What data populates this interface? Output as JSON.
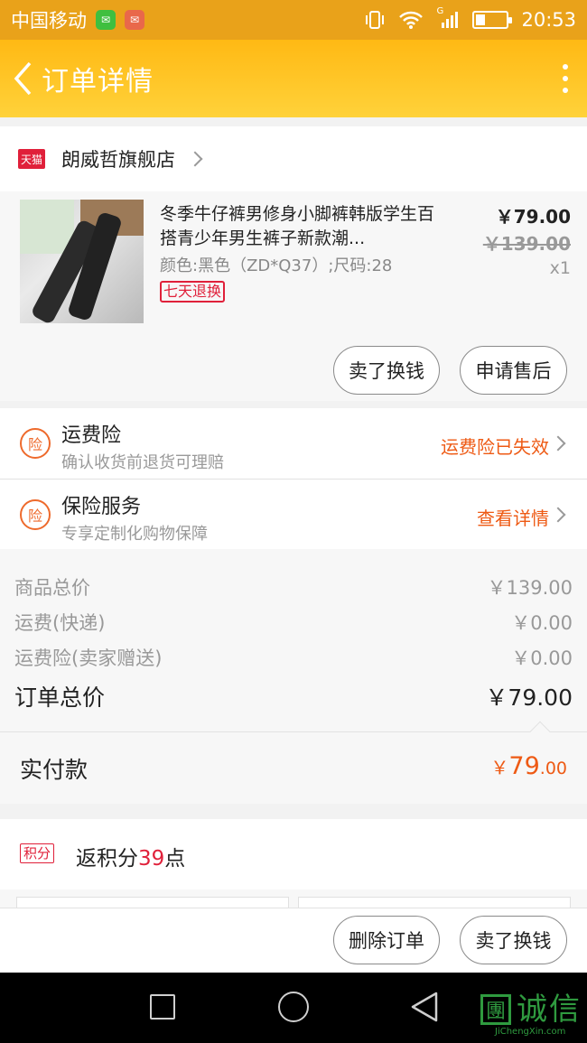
{
  "status_bar": {
    "carrier": "中国移动",
    "time": "20:53",
    "network_label": "G",
    "icons": [
      "wechat-icon",
      "mail-icon",
      "vibrate-icon",
      "wifi-icon",
      "signal-icon",
      "battery-icon"
    ],
    "battery_level": 0.3
  },
  "header": {
    "title": "订单详情",
    "background": "#ffc21f"
  },
  "shop": {
    "badge": "天猫",
    "name": "朗威哲旗舰店"
  },
  "product": {
    "title": "冬季牛仔裤男修身小脚裤韩版学生百搭青少年男生裤子新款潮...",
    "spec": "颜色:黑色（ZD*Q37）;尺码:28",
    "tag": "七天退换",
    "price": "￥79.00",
    "original_price": "￥139.00",
    "quantity": "x1",
    "buttons": {
      "sell": "卖了换钱",
      "after_sale": "申请售后"
    }
  },
  "insurance": [
    {
      "icon_text": "险",
      "title": "运费险",
      "subtitle": "确认收货前退货可理赔",
      "action": "运费险已失效"
    },
    {
      "icon_text": "险",
      "title": "保险服务",
      "subtitle": "专享定制化购物保障",
      "action": "查看详情"
    }
  ],
  "totals": {
    "rows": [
      {
        "label": "商品总价",
        "value": "￥139.00"
      },
      {
        "label": "运费(快递)",
        "value": "￥0.00"
      },
      {
        "label": "运费险(卖家赠送)",
        "value": "￥0.00"
      }
    ],
    "order_total_label": "订单总价",
    "order_total_value": "￥79.00",
    "paid_label": "实付款",
    "paid_currency": "￥",
    "paid_int": "79",
    "paid_dec": ".00"
  },
  "points": {
    "badge": "积分",
    "prefix": "返积分",
    "number": "39",
    "suffix": "点"
  },
  "actions": {
    "delete": "删除订单",
    "sell": "卖了换钱"
  },
  "watermark": {
    "box_char": "團",
    "text": "诚信",
    "url": "JiChengXin.com"
  },
  "colors": {
    "accent": "#ee5a14",
    "tmall_red": "#e0203a",
    "status_bar": "#e9a21a"
  }
}
